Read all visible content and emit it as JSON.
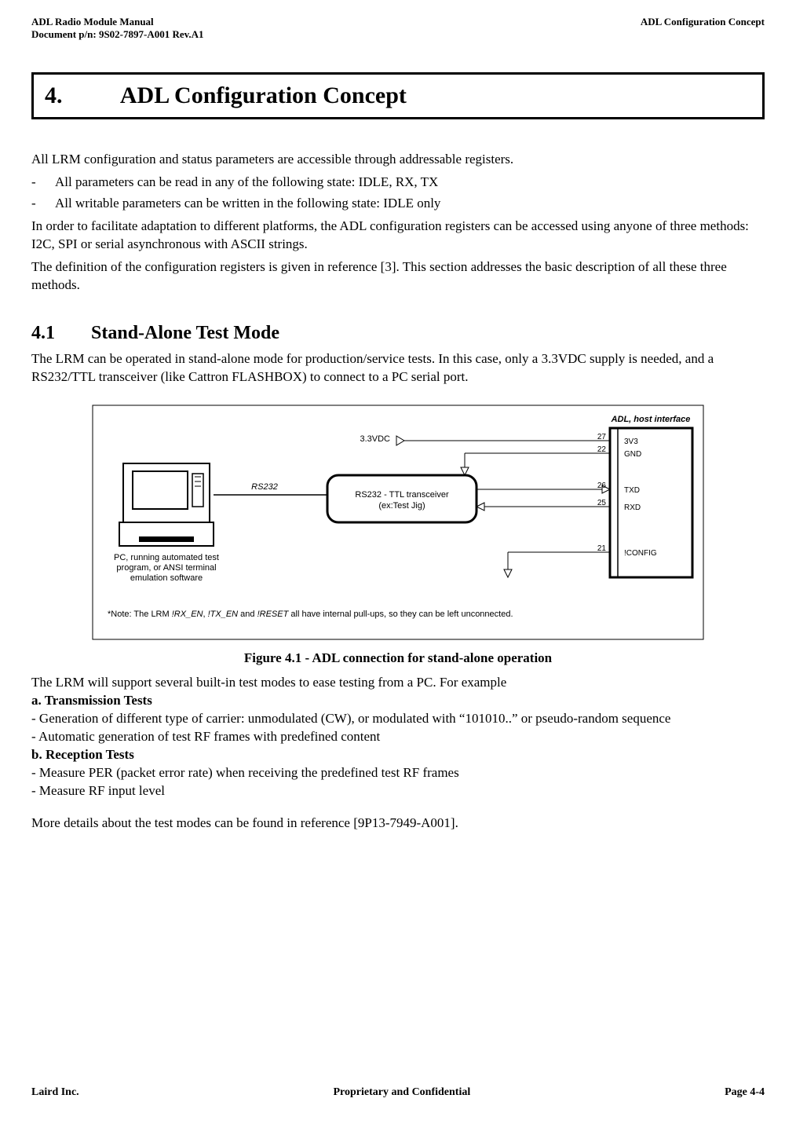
{
  "header": {
    "left_line1": "ADL Radio Module Manual",
    "left_line2": "Document p/n: 9S02-7897-A001 Rev.A1",
    "right": "ADL Configuration Concept"
  },
  "chapter": {
    "number": "4.",
    "title": "ADL Configuration Concept"
  },
  "intro": {
    "p1": "All LRM configuration and status parameters are accessible through addressable registers.",
    "bullet1": "All parameters can be read in any of the following state: IDLE, RX, TX",
    "bullet2": "All writable parameters can be written in the following state: IDLE only",
    "p2": "In order to facilitate adaptation to different platforms, the ADL configuration registers can be accessed using anyone of three methods: I2C, SPI or serial asynchronous with ASCII strings.",
    "p3": "The definition of the configuration registers is given in reference [3].  This section addresses the basic description of all these three methods."
  },
  "section41": {
    "number": "4.1",
    "title": "Stand-Alone Test Mode",
    "p1": "The LRM can be operated in stand-alone mode for production/service tests.  In this case, only a 3.3VDC supply is needed, and a RS232/TTL transceiver (like Cattron FLASHBOX) to connect to a PC serial port."
  },
  "figure": {
    "caption": "Figure 4.1 - ADL connection for stand-alone operation",
    "pc_caption_l1": "PC, running automated test",
    "pc_caption_l2": "program, or ANSI terminal",
    "pc_caption_l3": "emulation software",
    "rs232_label": "RS232",
    "transceiver_l1": "RS232 - TTL transceiver",
    "transceiver_l2": "(ex:Test Jig)",
    "vdc_label": "3.3VDC",
    "adl_header": "ADL, host interface",
    "pins": {
      "p27": "27",
      "l27": "3V3",
      "p22": "22",
      "l22": "GND",
      "p26": "26",
      "l26": "TXD",
      "p25": "25",
      "l25": "RXD",
      "p21": "21",
      "l21": "!CONFIG"
    },
    "note_prefix": "*Note: The LRM ",
    "note_sig1": "!RX_EN",
    "note_mid1": ", ",
    "note_sig2": "!TX_EN",
    "note_mid2": " and ",
    "note_sig3": "!RESET",
    "note_suffix": " all have internal pull-ups, so they can be left unconnected."
  },
  "after_fig": {
    "p1": "The LRM will support several built-in test modes to ease testing from a PC.  For example",
    "a_head": "a. Transmission Tests",
    "a_l1": "- Generation of different type of carrier: unmodulated (CW), or modulated with “101010..” or pseudo-random sequence",
    "a_l2": "- Automatic generation of test RF frames with predefined content",
    "b_head": "b. Reception Tests",
    "b_l1": "- Measure PER (packet error rate) when receiving the predefined test RF frames",
    "b_l2": "- Measure RF input level",
    "p2": "More details about the test modes can be found in reference [9P13-7949-A001]."
  },
  "footer": {
    "left": "Laird Inc.",
    "center": "Proprietary and Confidential",
    "right": "Page  4-4"
  }
}
